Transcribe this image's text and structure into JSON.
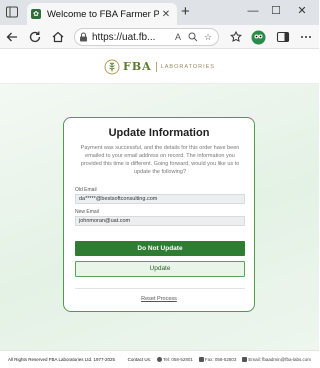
{
  "browser": {
    "tab_title": "Welcome to FBA Farmer Portal",
    "tab_close": "✕",
    "new_tab": "+",
    "url": "https://uat.fb...",
    "window_controls": {
      "minimize": "—",
      "maximize": "☐",
      "close": "✕"
    }
  },
  "header": {
    "logo_text": "FBA",
    "logo_subtitle": "LABORATORIES"
  },
  "card": {
    "title": "Update Information",
    "message": "Payment was successful, and the details for this order have been emailed to your email address on record. The information you provided this time is different. Going forward, would you like us to update the following?",
    "old_email_label": "Old Email",
    "old_email_value": "da*****@bestsoftconsulting.com",
    "new_email_label": "New Email",
    "new_email_value": "johnmoran@uat.com",
    "do_not_update_label": "Do Not Update",
    "update_label": "Update",
    "reset_label": "Reset Process"
  },
  "footer": {
    "copyright": "All Rights Reserved FBA Laboratories Ltd. 1977-2025",
    "contact_label": "Contact Us:",
    "tel": "Tel: 058-52801",
    "fax": "Fax: 058-52803",
    "email": "Email: fbaadmin@fba-labs.com"
  },
  "colors": {
    "brand_green": "#2e7d32",
    "card_border": "#4f9a4f",
    "logo_gold": "#9b8a63"
  }
}
